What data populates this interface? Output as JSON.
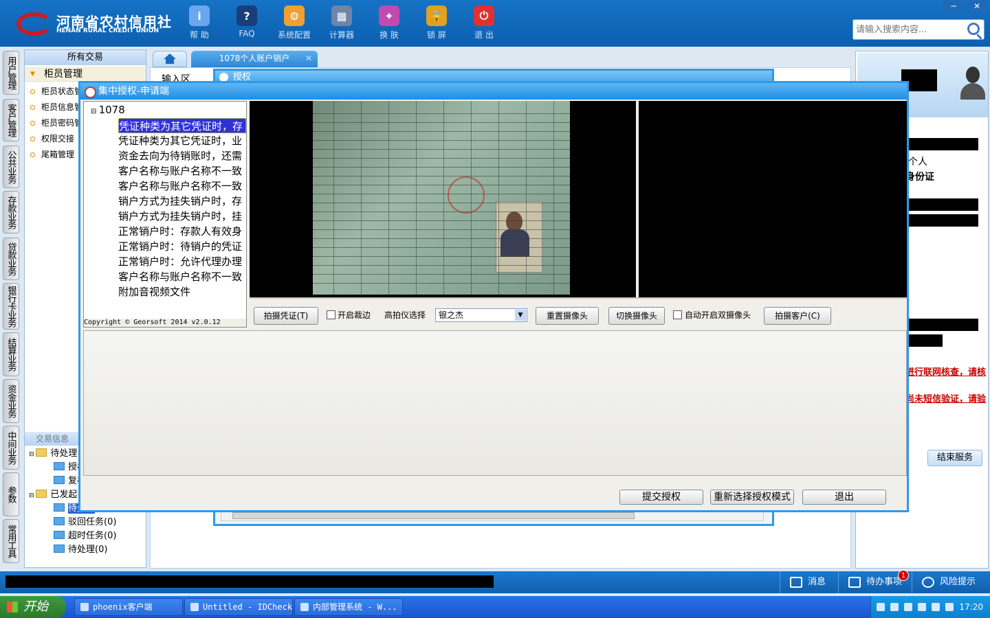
{
  "header": {
    "logo_cn": "河南省农村信用社",
    "logo_en": "HENAN RURAL CREDIT UNION",
    "toolbar": [
      {
        "label": "帮 助",
        "icon": "info-icon",
        "color": "#6aa7f0",
        "glyph": "i"
      },
      {
        "label": "FAQ",
        "icon": "help-icon",
        "color": "#1a3e7a",
        "glyph": "?"
      },
      {
        "label": "系统配置",
        "icon": "settings-icon",
        "color": "#f0a030",
        "glyph": "⚙"
      },
      {
        "label": "计算器",
        "icon": "calculator-icon",
        "color": "#6f86a8",
        "glyph": "▦"
      },
      {
        "label": "换 肤",
        "icon": "skin-icon",
        "color": "#c04ab0",
        "glyph": "✦"
      },
      {
        "label": "锁 屏",
        "icon": "lock-icon",
        "color": "#e0a020",
        "glyph": "🔒"
      },
      {
        "label": "退 出",
        "icon": "power-icon",
        "color": "#e03030",
        "glyph": "⏻"
      }
    ],
    "search_placeholder": "请输入搜索内容...",
    "window_controls": [
      "─",
      "✕"
    ]
  },
  "vnav": [
    "用户管理",
    "客户管理",
    "公共业务",
    "存款业务",
    "贷款业务",
    "银行卡业务",
    "结算业务",
    "资金业务",
    "中间业务",
    "参数",
    "常用工具"
  ],
  "left_menu": {
    "title": "所有交易",
    "group": "柜员管理",
    "items": [
      "柜员状态管",
      "柜员信息管",
      "柜员密码管",
      "权限交接",
      "尾箱管理"
    ],
    "info_title": "交易信息",
    "tree": {
      "pending": "待处理",
      "pending_children": [
        "授权",
        "复核"
      ],
      "initiated": "已发起",
      "initiated_children": [
        "待处理",
        "驳回任务(0)",
        "超时任务(0)",
        "待处理(0)"
      ]
    }
  },
  "tabs": {
    "active": "1078个人账户销户",
    "close": "✕"
  },
  "main": {
    "input_label": "输入区",
    "auth_title": "授权"
  },
  "dialog": {
    "title": "集中授权-申请端",
    "tree_root": "1078",
    "tree_items": [
      "凭证种类为其它凭证时，存",
      "凭证种类为其它凭证时，业",
      "资金去向为待销账时，还需",
      "客户名称与账户名称不一致",
      "客户名称与账户名称不一致",
      "销户方式为挂失销户时，存",
      "销户方式为挂失销户时，挂",
      "正常销户时：存款人有效身",
      "正常销户时：待销户的凭证",
      "正常销户时：允许代理办理",
      "客户名称与账户名称不一致",
      "附加音视频文件"
    ],
    "copyright": "Copyright © Georsoft 2014 v2.0.12",
    "controls": {
      "capture_voucher": "拍摄凭证(T)",
      "crop_label": "开启裁边",
      "scanner_label": "高拍仪选择",
      "scanner_value": "银之杰",
      "reset_camera": "重置摄像头",
      "switch_camera": "切换摄像头",
      "dual_camera_label": "自动开启双摄像头",
      "capture_customer": "拍摄客户(C)"
    },
    "buttons": {
      "submit": "提交授权",
      "reselect": "重新选择授权模式",
      "exit": "退出"
    }
  },
  "right_panel": {
    "personal": "个人",
    "id_type": "身份证",
    "warning1": "进行联网核查，请核",
    "warning2": "尚未短信验证，请验",
    "end_service": "结束服务"
  },
  "statusbar": {
    "message": "消息",
    "todo": "待办事项",
    "todo_count": "1",
    "risk": "风险提示"
  },
  "taskbar": {
    "start": "开始",
    "tasks": [
      "phoenix客户端",
      "Untitled - IDCheck",
      "内部管理系统 - W..."
    ],
    "clock": "17:20"
  }
}
